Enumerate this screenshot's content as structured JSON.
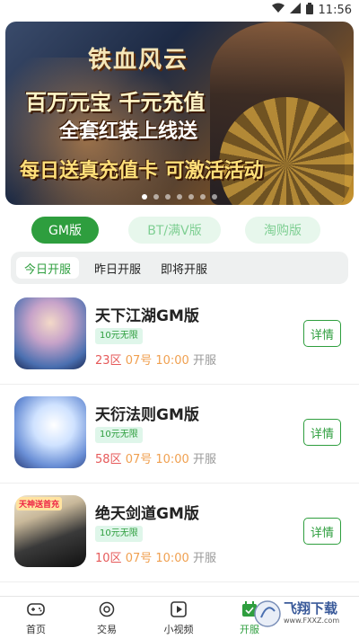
{
  "status_bar": {
    "time": "11:56"
  },
  "banner": {
    "logo_text": "铁血风云",
    "lines": [
      "百万元宝 千元充值",
      "全套红装上线送",
      "每日送真充值卡 可激活活动"
    ],
    "dots_count": 7,
    "active_dot": 0
  },
  "version_tabs": [
    {
      "label": "GM版",
      "active": true
    },
    {
      "label": "BT/满V版",
      "active": false
    },
    {
      "label": "淘购版",
      "active": false
    }
  ],
  "day_tabs": [
    {
      "label": "今日开服",
      "active": true
    },
    {
      "label": "昨日开服",
      "active": false
    },
    {
      "label": "即将开服",
      "active": false
    }
  ],
  "servers": [
    {
      "name": "天下江湖GM版",
      "tag": "10元无限",
      "zone": "23区",
      "date": "07号 10:00",
      "status": "开服",
      "button": "详情"
    },
    {
      "name": "天衍法则GM版",
      "tag": "10元无限",
      "zone": "58区",
      "date": "07号 10:00",
      "status": "开服",
      "button": "详情"
    },
    {
      "name": "绝天剑道GM版",
      "tag": "10元无限",
      "zone": "10区",
      "date": "07号 10:00",
      "status": "开服",
      "button": "详情",
      "thumb_badge": "天神送首充"
    }
  ],
  "bottom_nav": [
    {
      "label": "首页",
      "icon": "gamepad-icon"
    },
    {
      "label": "交易",
      "icon": "trade-icon"
    },
    {
      "label": "小视频",
      "icon": "video-icon"
    },
    {
      "label": "开服",
      "icon": "calendar-icon",
      "active": true
    }
  ],
  "watermark": {
    "text": "飞翔下载",
    "url_text": "www.FXXZ.com"
  },
  "colors": {
    "accent": "#2e9e3e",
    "zone": "#e65a5a",
    "date": "#f0a050"
  }
}
